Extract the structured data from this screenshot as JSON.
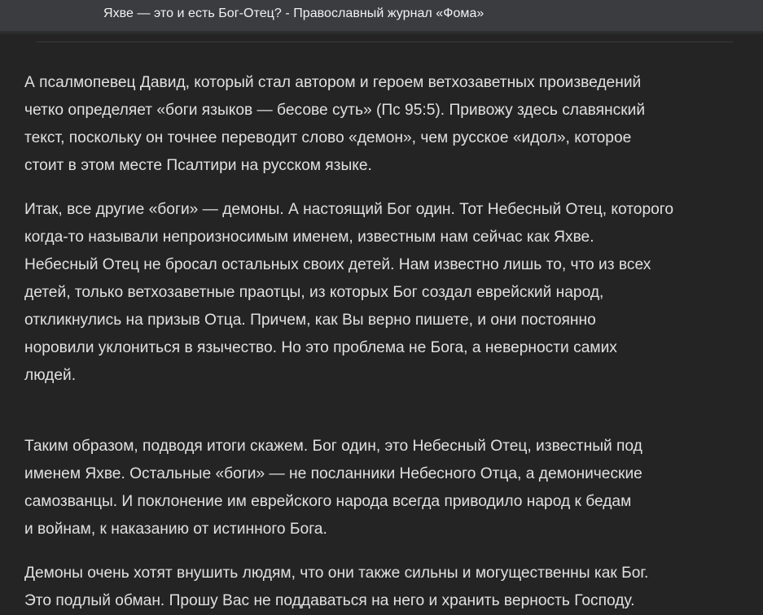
{
  "window": {
    "title": "Яхве — это и есть Бог-Отец? - Православный журнал «Фома»"
  },
  "article": {
    "paragraphs": [
      "А псалмопевец Давид, который стал автором и героем ветхозаветных произведений\nчетко определяет «боги языков — бесове суть» (Пс 95:5). Привожу здесь славянский\nтекст, поскольку он точнее переводит слово «демон», чем русское «идол», которое\nстоит в этом месте Псалтири на русском языке.",
      "Итак, все другие «боги» — демоны. А настоящий Бог один. Тот Небесный Отец, которого\nкогда-то называли непроизносимым именем, известным нам сейчас как Яхве.\nНебесный Отец не бросал остальных своих детей. Нам известно лишь то, что из всех\nдетей, только ветхозаветные праотцы, из которых Бог создал еврейский народ,\nоткликнулись на призыв Отца. Причем, как Вы верно пишете, и они постоянно\nноровили уклониться в язычество. Но это проблема не Бога, а неверности самих\nлюдей.",
      "Таким образом, подводя итоги скажем. Бог один, это Небесный Отец, известный под\nименем Яхве. Остальные «боги» — не посланники Небесного Отца, а демонические\nсамозванцы. И поклонение им еврейского народа всегда приводило народ к бедам\nи войнам, к наказанию от истинного Бога.",
      "Демоны очень хотят внушить людям, что они также сильны и могущественны как Бог.\nЭто подлый обман. Прошу Вас не поддаваться на него и хранить верность Господу."
    ]
  }
}
